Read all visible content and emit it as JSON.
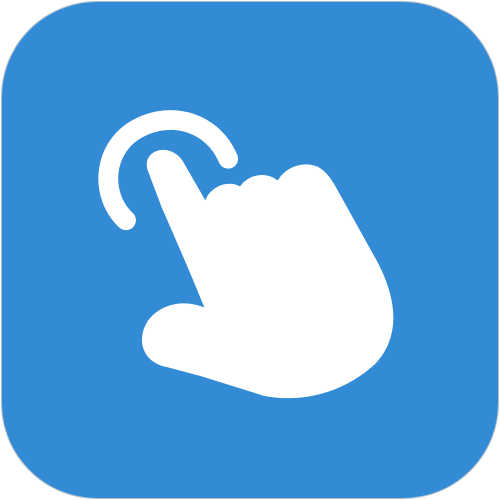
{
  "app_icon": {
    "icon": "tap-gesture-icon",
    "colors": {
      "background": "#338bd5",
      "glyph": "#ffffff",
      "border": "#b9c0c7"
    }
  }
}
